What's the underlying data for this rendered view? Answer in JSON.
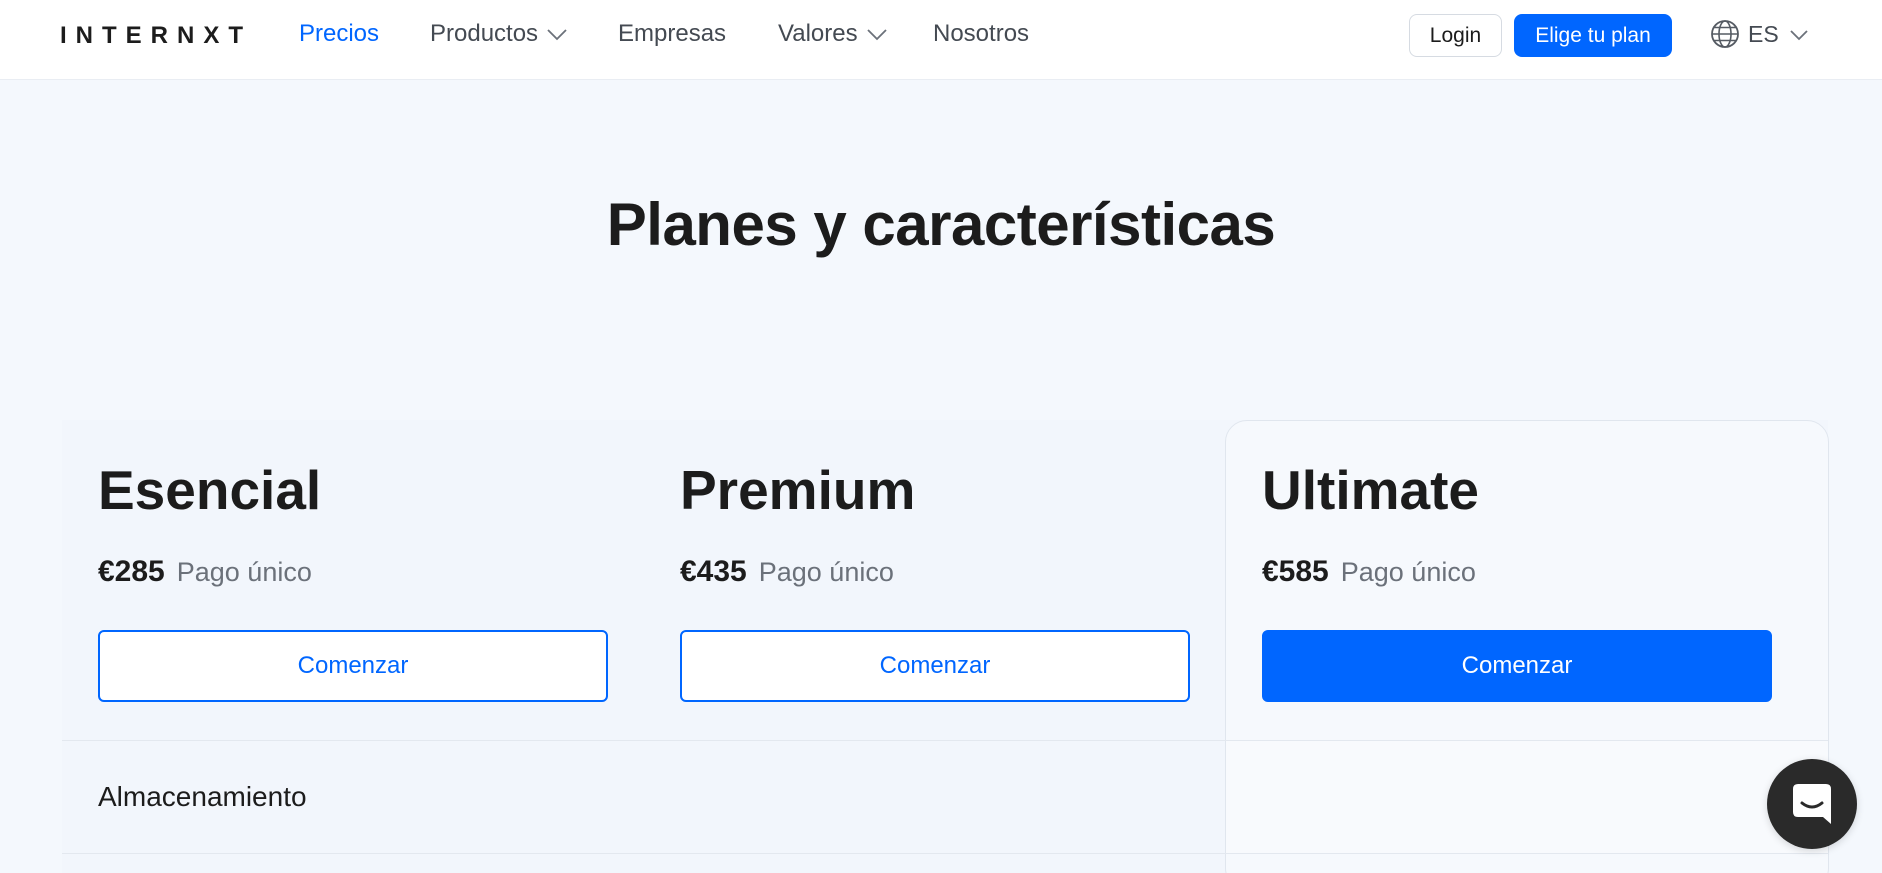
{
  "header": {
    "logo": "INTERNXT",
    "nav": [
      {
        "label": "Precios",
        "active": true,
        "has_dropdown": false
      },
      {
        "label": "Productos",
        "active": false,
        "has_dropdown": true
      },
      {
        "label": "Empresas",
        "active": false,
        "has_dropdown": false
      },
      {
        "label": "Valores",
        "active": false,
        "has_dropdown": true
      },
      {
        "label": "Nosotros",
        "active": false,
        "has_dropdown": false
      }
    ],
    "login_label": "Login",
    "cta_label": "Elige tu plan",
    "language": {
      "icon": "globe-icon",
      "code": "ES"
    }
  },
  "main": {
    "title": "Planes y características",
    "plans": [
      {
        "name": "Esencial",
        "price": "€285",
        "price_note": "Pago único",
        "button_label": "Comenzar",
        "featured": false
      },
      {
        "name": "Premium",
        "price": "€435",
        "price_note": "Pago único",
        "button_label": "Comenzar",
        "featured": false
      },
      {
        "name": "Ultimate",
        "price": "€585",
        "price_note": "Pago único",
        "button_label": "Comenzar",
        "featured": true
      }
    ],
    "features": [
      {
        "label": "Almacenamiento"
      }
    ]
  },
  "chat_widget": {
    "icon": "chat-icon"
  },
  "colors": {
    "accent": "#0066ff",
    "text": "#1c1c1c",
    "muted": "#6b717a",
    "background": "#f4f8fd",
    "chat": "#2a2a2a"
  }
}
